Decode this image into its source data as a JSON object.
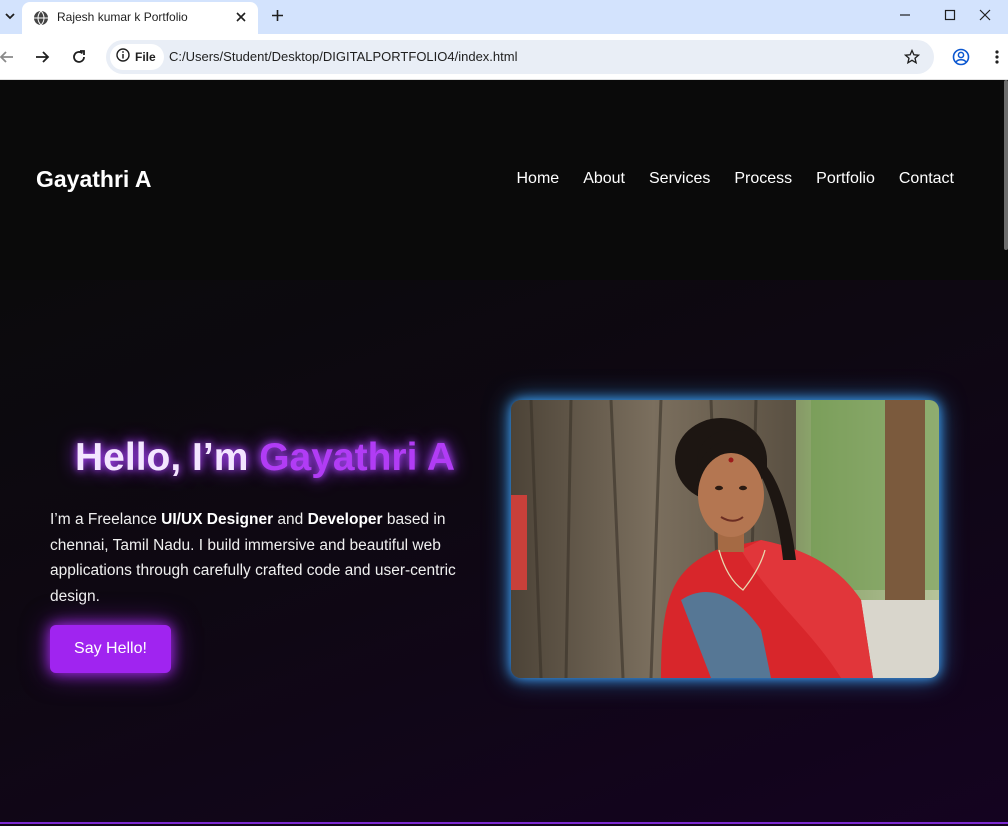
{
  "browser": {
    "tab_title": "Rajesh kumar k Portfolio",
    "tab_menu_icon": "chevron-down-icon",
    "favicon_icon": "globe-icon",
    "security_chip_label": "File",
    "url": "C:/Users/Student/Desktop/DIGITALPORTFOLIO4/index.html"
  },
  "site": {
    "logo": "Gayathri A",
    "nav": [
      {
        "label": "Home"
      },
      {
        "label": "About"
      },
      {
        "label": "Services"
      },
      {
        "label": "Process"
      },
      {
        "label": "Portfolio"
      },
      {
        "label": "Contact"
      }
    ]
  },
  "hero": {
    "title_prefix": "Hello, I’m ",
    "title_name": "Gayathri A",
    "desc_part1": "I’m a Freelance ",
    "desc_bold1": "UI/UX Designer",
    "desc_part2": " and ",
    "desc_bold2": "Developer",
    "desc_part3": " based in chennai, Tamil Nadu. I build immersive and beautiful web applications through carefully crafted code and user-centric design.",
    "cta_label": "Say Hello!"
  },
  "colors": {
    "accent_purple": "#a024f0",
    "name_purple": "#b13cf5",
    "photo_glow": "#3ea6ff",
    "tabbar_bg": "#d3e3fd",
    "page_bg": "#0a0a0a"
  }
}
